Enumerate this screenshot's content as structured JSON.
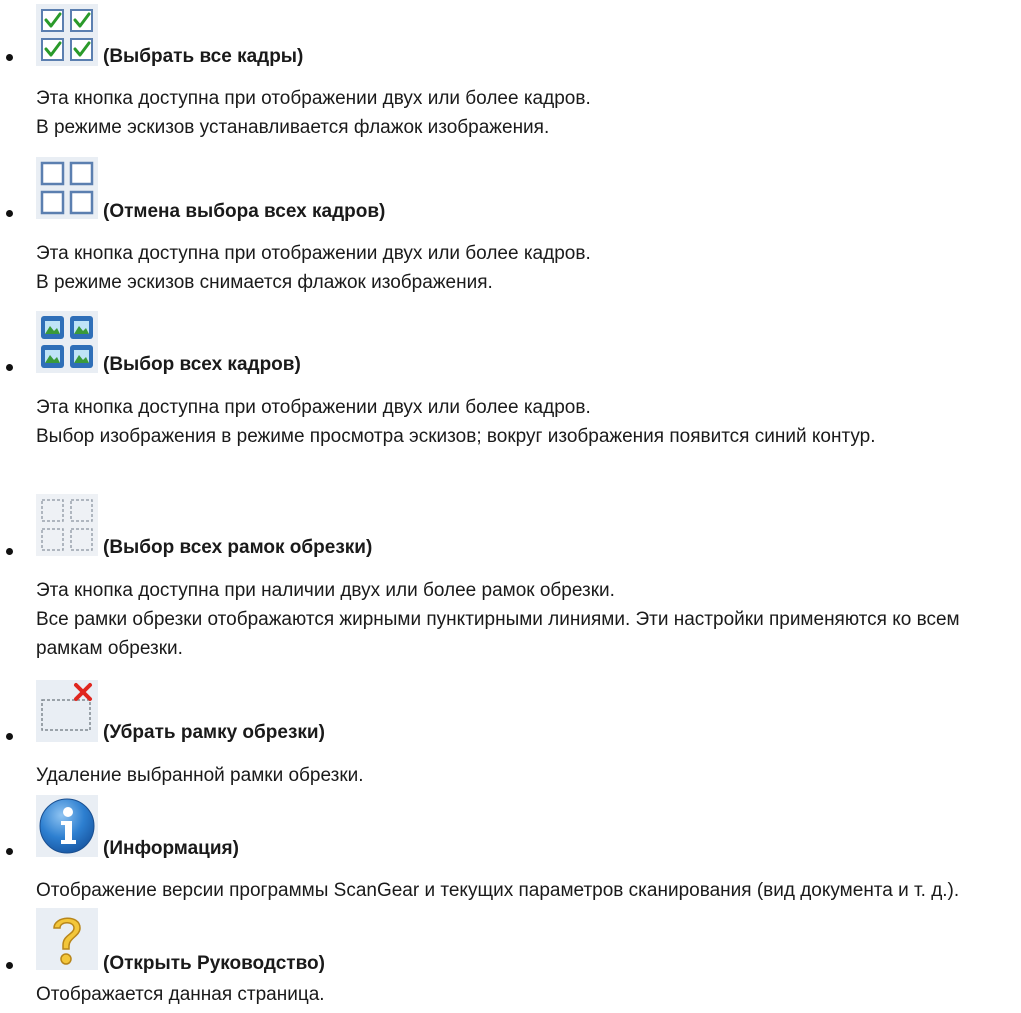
{
  "items": [
    {
      "icon": "select-all-checkbox-icon",
      "title": "(Выбрать все кадры)",
      "lines": [
        "Эта кнопка доступна при отображении двух или более кадров.",
        "В режиме эскизов устанавливается флажок изображения."
      ]
    },
    {
      "icon": "deselect-all-checkbox-icon",
      "title": "(Отмена выбора всех кадров)",
      "lines": [
        "Эта кнопка доступна при отображении двух или более кадров.",
        "В режиме эскизов снимается флажок изображения."
      ]
    },
    {
      "icon": "select-all-frames-icon",
      "title": "(Выбор всех кадров)",
      "lines": [
        "Эта кнопка доступна при отображении двух или более кадров.",
        "Выбор изображения в режиме просмотра эскизов; вокруг изображения появится синий контур."
      ]
    },
    {
      "icon": "select-all-crop-frames-icon",
      "title": "(Выбор всех рамок обрезки)",
      "lines": [
        "Эта кнопка доступна при наличии двух или более рамок обрезки.",
        "Все рамки обрезки отображаются жирными пунктирными линиями. Эти настройки применяются ко всем рамкам обрезки."
      ]
    },
    {
      "icon": "remove-crop-frame-icon",
      "title": "(Убрать рамку обрезки)",
      "lines": [
        "Удаление выбранной рамки обрезки."
      ]
    },
    {
      "icon": "information-icon",
      "title": "(Информация)",
      "lines": [
        "Отображение версии программы ScanGear и текущих параметров сканирования (вид документа и т. д.)."
      ]
    },
    {
      "icon": "help-guide-icon",
      "title": "(Открыть Руководство)",
      "lines": [
        "Отображается данная страница."
      ]
    }
  ]
}
